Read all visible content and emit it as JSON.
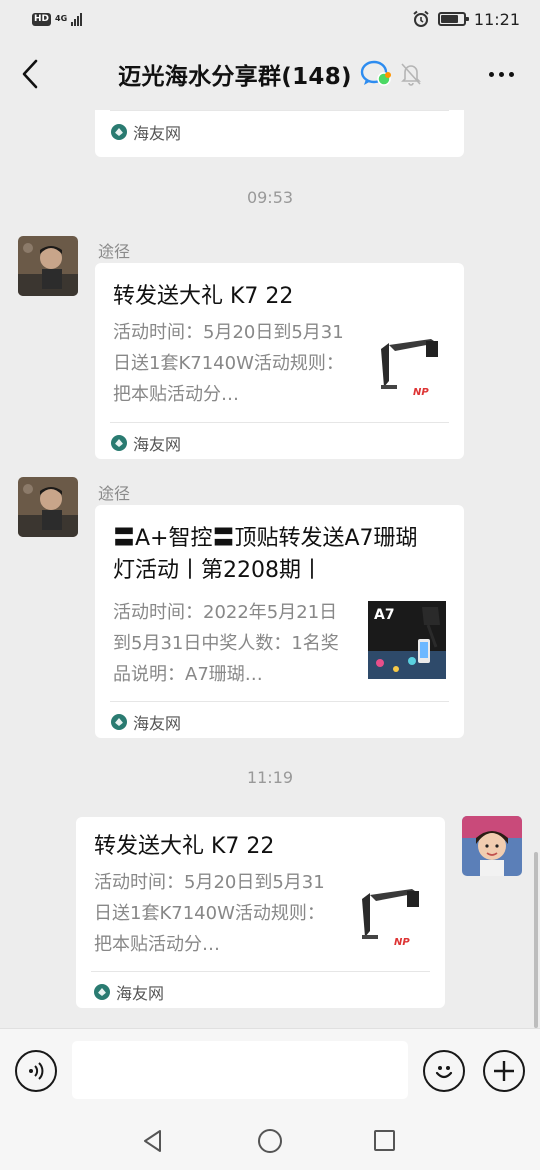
{
  "status_bar": {
    "hd_badge": "HD",
    "network": "4G",
    "time": "11:21",
    "battery_level": 0.8
  },
  "header": {
    "title": "迈光海水分享群(148)",
    "icons": [
      "chevron-left-icon",
      "group-chat-icon",
      "mute-bell-icon",
      "more-dots-icon"
    ]
  },
  "messages": [
    {
      "type": "card-tail",
      "source": "海友网"
    },
    {
      "type": "time",
      "time": "09:53"
    },
    {
      "type": "card",
      "sender": "途径",
      "title": "转发送大礼 K7 22",
      "desc": "活动时间：5月20日到5月31日送1套K7140W活动规则：把本贴活动分…",
      "thumb": "lamp-product-image",
      "source": "海友网"
    },
    {
      "type": "card",
      "sender": "途径",
      "title": "〓A+智控〓顶贴转发送A7珊瑚灯活动丨第2208期丨",
      "desc": "活动时间：2022年5月21日到5月31日中奖人数：1名奖品说明：A7珊瑚…",
      "thumb": "a7-product-image",
      "thumb_label": "A7",
      "source": "海友网"
    },
    {
      "type": "time",
      "time": "11:19"
    },
    {
      "type": "card",
      "self": true,
      "title": "转发送大礼 K7 22",
      "desc": "活动时间：5月20日到5月31日送1套K7140W活动规则：把本贴活动分…",
      "thumb": "lamp-product-image",
      "source": "海友网"
    }
  ],
  "input_bar": {
    "placeholder": "",
    "icons": [
      "voice-icon",
      "emoji-icon",
      "plus-icon"
    ]
  },
  "nav_bar": {
    "icons": [
      "nav-back-icon",
      "nav-home-icon",
      "nav-recent-icon"
    ]
  },
  "colors": {
    "chat_bg": "#ededed",
    "card_bg": "#ffffff",
    "source_icon": "#2a7b71",
    "time_text": "#999999"
  }
}
